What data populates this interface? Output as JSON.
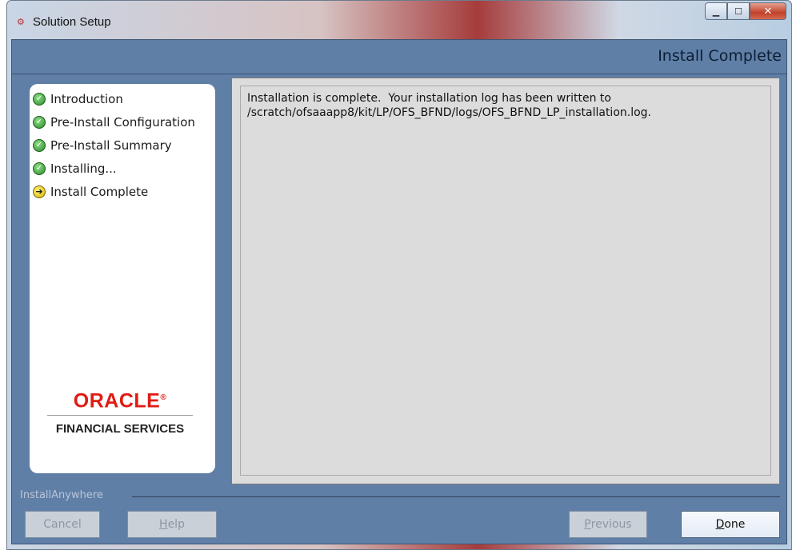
{
  "window": {
    "title": "Solution Setup",
    "icon": "installer-app-icon",
    "controls": {
      "minimize": "minimize",
      "maximize": "maximize",
      "close": "close"
    }
  },
  "header": {
    "title": "Install Complete"
  },
  "steps": [
    {
      "label": "Introduction",
      "status": "done"
    },
    {
      "label": "Pre-Install Configuration",
      "status": "done"
    },
    {
      "label": "Pre-Install Summary",
      "status": "done"
    },
    {
      "label": "Installing...",
      "status": "done"
    },
    {
      "label": "Install Complete",
      "status": "current"
    }
  ],
  "logo": {
    "brand": "ORACLE",
    "subtitle": "FINANCIAL SERVICES"
  },
  "content": {
    "message_line1": "Installation is complete.  Your installation log has been written to",
    "message_line2": "/scratch/ofsaaapp8/kit/LP/OFS_BFND/logs/OFS_BFND_LP_installation.log."
  },
  "footer": {
    "label": "InstallAnywhere",
    "buttons": {
      "cancel": {
        "label": "Cancel",
        "enabled": false
      },
      "help": {
        "label": "Help",
        "enabled": false
      },
      "previous": {
        "label": "Previous",
        "enabled": false
      },
      "done": {
        "label": "Done",
        "enabled": true
      }
    }
  },
  "colors": {
    "brand_red": "#e01b14",
    "panel_blue": "#5f7fa7",
    "done_green": "#2a8a27",
    "current_yellow": "#d7b800"
  }
}
